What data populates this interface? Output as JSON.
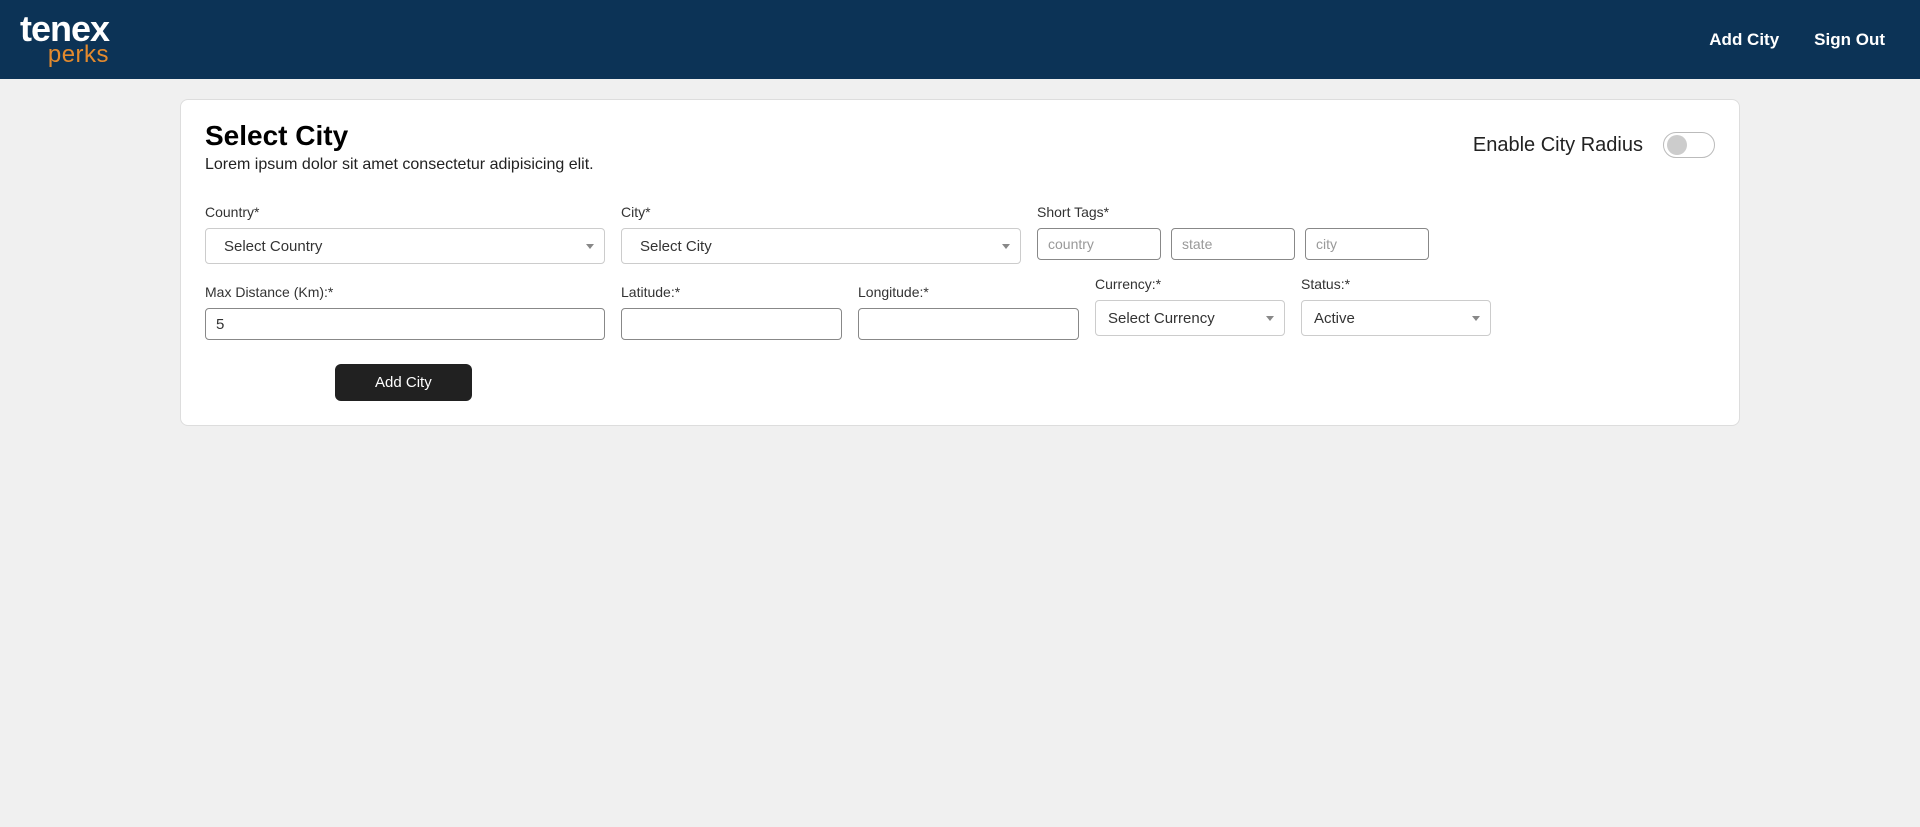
{
  "header": {
    "logo_main": "tenex",
    "logo_sub": "perks",
    "nav": {
      "add_city": "Add City",
      "sign_out": "Sign Out"
    }
  },
  "card": {
    "title": "Select City",
    "subtitle": "Lorem ipsum dolor sit amet consectetur adipisicing elit.",
    "toggle_label": "Enable City Radius",
    "toggle_on": false
  },
  "form": {
    "country": {
      "label": "Country*",
      "selected": "Select Country"
    },
    "city": {
      "label": "City*",
      "selected": "Select City"
    },
    "short_tags": {
      "label": "Short Tags*",
      "placeholders": {
        "country": "country",
        "state": "state",
        "city": "city"
      }
    },
    "max_distance": {
      "label": "Max Distance (Km):*",
      "value": "5"
    },
    "latitude": {
      "label": "Latitude:*",
      "value": ""
    },
    "longitude": {
      "label": "Longitude:*",
      "value": ""
    },
    "currency": {
      "label": "Currency:*",
      "selected": "Select Currency"
    },
    "status": {
      "label": "Status:*",
      "selected": "Active"
    },
    "submit_label": "Add City"
  }
}
